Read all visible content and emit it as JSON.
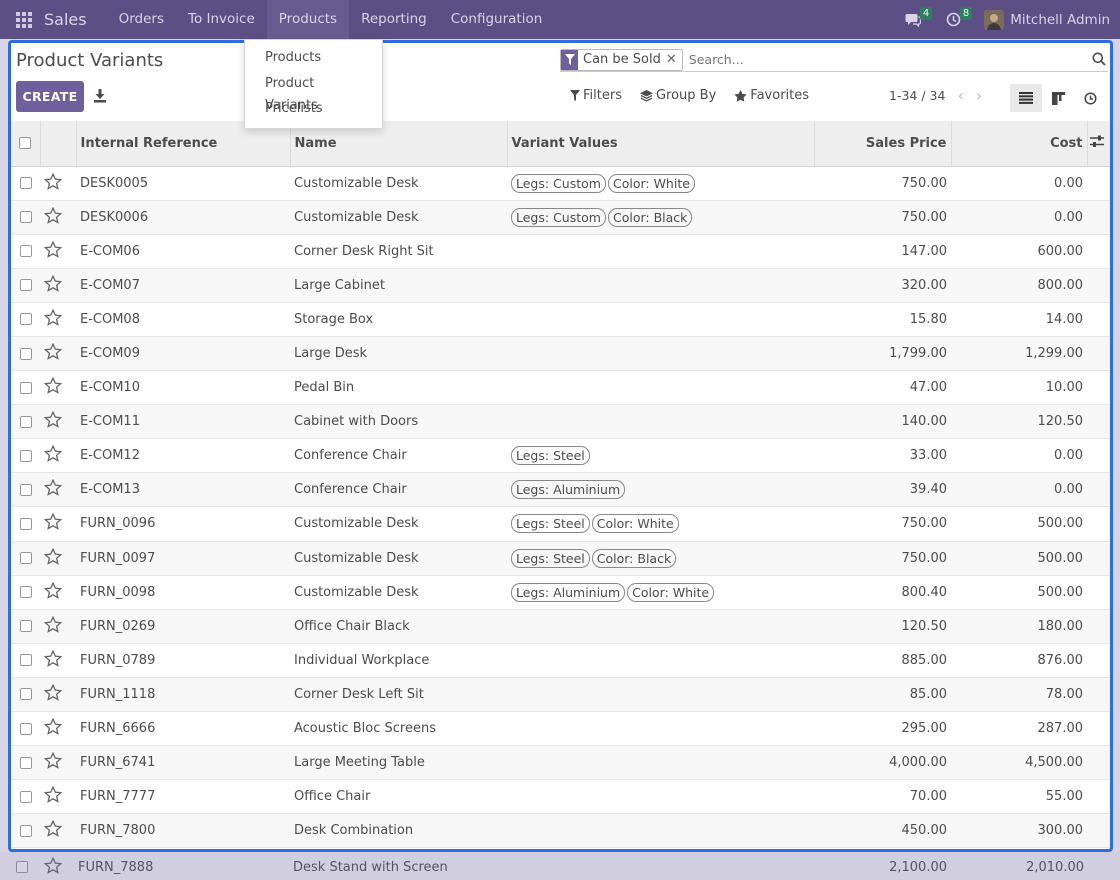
{
  "navbar": {
    "brand": "Sales",
    "menu": [
      {
        "label": "Orders"
      },
      {
        "label": "To Invoice"
      },
      {
        "label": "Products"
      },
      {
        "label": "Reporting"
      },
      {
        "label": "Configuration"
      }
    ],
    "messages_count": "4",
    "activities_count": "8",
    "user_name": "Mitchell Admin"
  },
  "dropdown": {
    "items": [
      {
        "label": "Products"
      },
      {
        "label": "Product Variants"
      },
      {
        "label": "Pricelists"
      }
    ]
  },
  "control_panel": {
    "title": "Product Variants",
    "create_label": "CREATE",
    "facet_label": "Can be Sold",
    "search_placeholder": "Search...",
    "filters_label": "Filters",
    "groupby_label": "Group By",
    "favorites_label": "Favorites",
    "pager": "1-34 / 34"
  },
  "table": {
    "columns": [
      "Internal Reference",
      "Name",
      "Variant Values",
      "Sales Price",
      "Cost"
    ],
    "rows": [
      {
        "ref": "DESK0005",
        "name": "Customizable Desk",
        "tags": [
          "Legs: Custom",
          "Color: White"
        ],
        "price": "750.00",
        "cost": "0.00"
      },
      {
        "ref": "DESK0006",
        "name": "Customizable Desk",
        "tags": [
          "Legs: Custom",
          "Color: Black"
        ],
        "price": "750.00",
        "cost": "0.00"
      },
      {
        "ref": "E-COM06",
        "name": "Corner Desk Right Sit",
        "tags": [],
        "price": "147.00",
        "cost": "600.00"
      },
      {
        "ref": "E-COM07",
        "name": "Large Cabinet",
        "tags": [],
        "price": "320.00",
        "cost": "800.00"
      },
      {
        "ref": "E-COM08",
        "name": "Storage Box",
        "tags": [],
        "price": "15.80",
        "cost": "14.00"
      },
      {
        "ref": "E-COM09",
        "name": "Large Desk",
        "tags": [],
        "price": "1,799.00",
        "cost": "1,299.00"
      },
      {
        "ref": "E-COM10",
        "name": "Pedal Bin",
        "tags": [],
        "price": "47.00",
        "cost": "10.00"
      },
      {
        "ref": "E-COM11",
        "name": "Cabinet with Doors",
        "tags": [],
        "price": "140.00",
        "cost": "120.50"
      },
      {
        "ref": "E-COM12",
        "name": "Conference Chair",
        "tags": [
          "Legs: Steel"
        ],
        "price": "33.00",
        "cost": "0.00"
      },
      {
        "ref": "E-COM13",
        "name": "Conference Chair",
        "tags": [
          "Legs: Aluminium"
        ],
        "price": "39.40",
        "cost": "0.00"
      },
      {
        "ref": "FURN_0096",
        "name": "Customizable Desk",
        "tags": [
          "Legs: Steel",
          "Color: White"
        ],
        "price": "750.00",
        "cost": "500.00"
      },
      {
        "ref": "FURN_0097",
        "name": "Customizable Desk",
        "tags": [
          "Legs: Steel",
          "Color: Black"
        ],
        "price": "750.00",
        "cost": "500.00"
      },
      {
        "ref": "FURN_0098",
        "name": "Customizable Desk",
        "tags": [
          "Legs: Aluminium",
          "Color: White"
        ],
        "price": "800.40",
        "cost": "500.00"
      },
      {
        "ref": "FURN_0269",
        "name": "Office Chair Black",
        "tags": [],
        "price": "120.50",
        "cost": "180.00"
      },
      {
        "ref": "FURN_0789",
        "name": "Individual Workplace",
        "tags": [],
        "price": "885.00",
        "cost": "876.00"
      },
      {
        "ref": "FURN_1118",
        "name": "Corner Desk Left Sit",
        "tags": [],
        "price": "85.00",
        "cost": "78.00"
      },
      {
        "ref": "FURN_6666",
        "name": "Acoustic Bloc Screens",
        "tags": [],
        "price": "295.00",
        "cost": "287.00"
      },
      {
        "ref": "FURN_6741",
        "name": "Large Meeting Table",
        "tags": [],
        "price": "4,000.00",
        "cost": "4,500.00"
      },
      {
        "ref": "FURN_7777",
        "name": "Office Chair",
        "tags": [],
        "price": "70.00",
        "cost": "55.00"
      },
      {
        "ref": "FURN_7800",
        "name": "Desk Combination",
        "tags": [],
        "price": "450.00",
        "cost": "300.00"
      }
    ],
    "below_row": {
      "ref": "FURN_7888",
      "name": "Desk Stand with Screen",
      "price": "2,100.00",
      "cost": "2,010.00"
    }
  }
}
